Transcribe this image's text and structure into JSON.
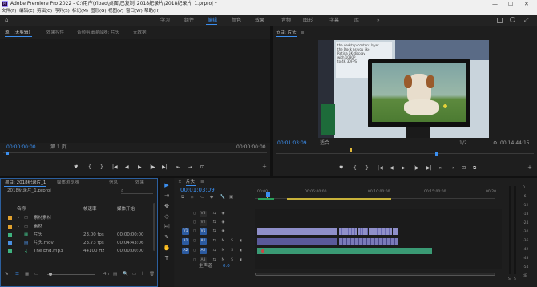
{
  "window": {
    "title": "Adobe Premiere Pro 2022 - C:\\用户\\Yibao\\桌面\\已复制_2018纪录片\\2018纪录片_1.prproj *",
    "app_icon": "Pr",
    "minimize": "—",
    "maximize": "☐",
    "close": "✕"
  },
  "menu": [
    "文件(F)",
    "编辑(E)",
    "剪辑(C)",
    "序列(S)",
    "标记(M)",
    "图形(G)",
    "视图(V)",
    "窗口(W)",
    "帮助(H)"
  ],
  "workspaces": {
    "items": [
      "学习",
      "组件",
      "编辑",
      "颜色",
      "效果",
      "音频",
      "图形",
      "字幕",
      "库"
    ],
    "active": "编辑",
    "more": "»"
  },
  "source_monitor": {
    "tabs": [
      "源:（无剪辑）",
      "效果控件",
      "音频剪辑混合器: 片头",
      "元数据"
    ],
    "timecode_left": "00:00:00:00",
    "page_label": "第 1 页",
    "timecode_right": "00:00:00:00",
    "controls": [
      "♥",
      "{",
      "}",
      "|◀",
      "◀|",
      "◀",
      "▶",
      "|▶",
      "▶|",
      "⇤",
      "⇥",
      "⊡",
      "＋"
    ]
  },
  "program_monitor": {
    "tab": "节目: 片头",
    "menu_icon": "≡",
    "timecode": "00:01:03:09",
    "fit": "适合",
    "resolution": "1/2",
    "duration": "00:14:44:15",
    "frame_text": [
      "the desktop content layer",
      "the Dock as you like",
      "Retina 5K display",
      "with 1080P",
      "to 4K 30FPS"
    ],
    "controls": [
      "♥",
      "{",
      "}",
      "|◀",
      "◀|",
      "◀",
      "▶",
      "|▶",
      "▶|",
      "⇤",
      "⇥",
      "⊡",
      "＋"
    ]
  },
  "project": {
    "tabs": [
      "项目: 2018纪录片_1",
      "媒体浏览器",
      "信息",
      "效果"
    ],
    "file": "2018纪录片_1.prproj",
    "search_icon": "search-icon",
    "columns": [
      "名称",
      "帧速率",
      "媒体开始"
    ],
    "items": [
      {
        "name": "素材素材",
        "rate": "",
        "start": "",
        "color": "#e0a12e",
        "type": "bin"
      },
      {
        "name": "素材",
        "rate": "",
        "start": "",
        "color": "#e0a12e",
        "type": "bin"
      },
      {
        "name": "片头",
        "rate": "23.00 fps",
        "start": "00:00:00:00",
        "color": "#3fb27f",
        "type": "seq"
      },
      {
        "name": "片头.mov",
        "rate": "23.73 fps",
        "start": "00:04:43:06",
        "color": "#4a90e2",
        "type": "clip"
      },
      {
        "name": "The End.mp3",
        "rate": "44100 Hz",
        "start": "00:00:00:00",
        "color": "#3fb27f",
        "type": "audio"
      }
    ],
    "bottom_icons": [
      "✎",
      "☰",
      "▦",
      "▭",
      "◯",
      "🔍",
      "＋",
      "▤",
      "🗑"
    ],
    "zoom_label": "4n"
  },
  "timeline": {
    "tab": "片头",
    "tab_menu": "≡",
    "close_label": "×",
    "timecode": "00:01:03:09",
    "ruler": [
      "00:00",
      "00:05:00:00",
      "00:10:00:00",
      "00:15:00:00",
      "00:20"
    ],
    "tracks": [
      {
        "id": "V3",
        "kind": "video"
      },
      {
        "id": "V2",
        "kind": "video"
      },
      {
        "id": "V1",
        "kind": "video"
      },
      {
        "id": "A1",
        "kind": "audio"
      },
      {
        "id": "A2",
        "kind": "audio"
      },
      {
        "id": "A3",
        "kind": "audio"
      }
    ],
    "master": "主声道",
    "master_value": "0.0",
    "track_controls": {
      "lock": "🔒",
      "eye": "👁",
      "m": "M",
      "s": "S",
      "mic": "🎤"
    }
  },
  "audio_meter": {
    "scale": [
      "0",
      "-6",
      "-12",
      "-18",
      "-24",
      "-30",
      "-36",
      "-42",
      "-48",
      "-54",
      "dB"
    ],
    "labels": [
      "S",
      "S"
    ]
  },
  "tools": [
    "▶",
    "⇥",
    "✥",
    "◇",
    "|↔|",
    "✎",
    "✋",
    "T"
  ]
}
